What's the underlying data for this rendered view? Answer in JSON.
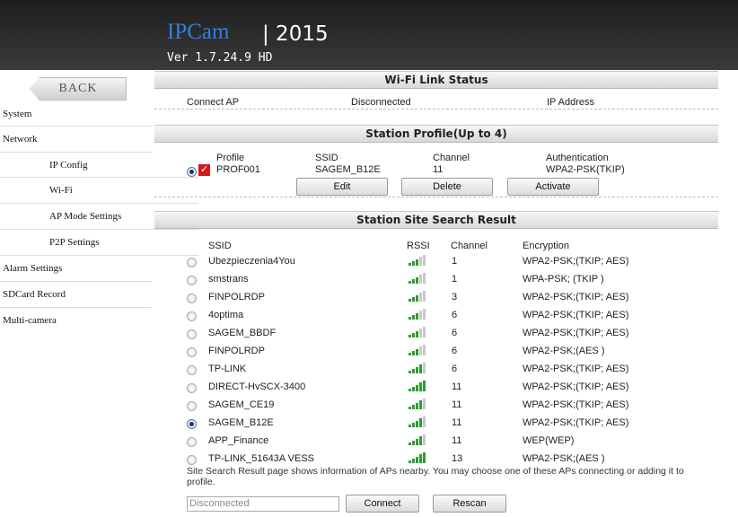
{
  "header": {
    "brand": "IPCam",
    "year": "| 2015",
    "version": "Ver  1.7.24.9 HD"
  },
  "sidebar": {
    "back": "BACK",
    "items": [
      {
        "label": "System"
      },
      {
        "label": "Network"
      },
      {
        "label": "IP Config"
      },
      {
        "label": "Wi-Fi"
      },
      {
        "label": "AP Mode Settings"
      },
      {
        "label": "P2P Settings"
      },
      {
        "label": "Alarm Settings"
      },
      {
        "label": "SDCard Record"
      },
      {
        "label": "Multi-camera"
      }
    ]
  },
  "link_status": {
    "title": "Wi-Fi Link Status",
    "connect_ap_label": "Connect AP",
    "connect_ap_value": "Disconnected",
    "ip_label": "IP Address"
  },
  "profile": {
    "title": "Station Profile(Up to 4)",
    "headers": [
      "Profile",
      "SSID",
      "Channel",
      "Authentication"
    ],
    "row": {
      "profile": "PROF001",
      "ssid": "SAGEM_B12E",
      "channel": "11",
      "auth": "WPA2-PSK(TKIP)"
    },
    "buttons": {
      "edit": "Edit",
      "delete": "Delete",
      "activate": "Activate"
    }
  },
  "search": {
    "title": "Station Site Search Result",
    "headers": [
      "SSID",
      "RSSI",
      "Channel",
      "Encryption"
    ],
    "rows": [
      {
        "ssid": "Ubezpieczenia4You",
        "rssi": 3,
        "channel": "1",
        "enc": "WPA2-PSK;(TKIP; AES)",
        "selected": false
      },
      {
        "ssid": "smstrans",
        "rssi": 3,
        "channel": "1",
        "enc": "WPA-PSK; (TKIP )",
        "selected": false
      },
      {
        "ssid": "FINPOLRDP",
        "rssi": 3,
        "channel": "3",
        "enc": "WPA2-PSK;(TKIP; AES)",
        "selected": false
      },
      {
        "ssid": "4optima",
        "rssi": 3,
        "channel": "6",
        "enc": "WPA2-PSK;(TKIP; AES)",
        "selected": false
      },
      {
        "ssid": "SAGEM_BBDF",
        "rssi": 3,
        "channel": "6",
        "enc": "WPA2-PSK;(TKIP; AES)",
        "selected": false
      },
      {
        "ssid": "FINPOLRDP",
        "rssi": 3,
        "channel": "6",
        "enc": "WPA2-PSK;(AES )",
        "selected": false
      },
      {
        "ssid": "TP-LINK",
        "rssi": 4,
        "channel": "6",
        "enc": "WPA2-PSK;(TKIP; AES)",
        "selected": false
      },
      {
        "ssid": "DIRECT-HvSCX-3400",
        "rssi": 5,
        "channel": "11",
        "enc": "WPA2-PSK;(TKIP; AES)",
        "selected": false
      },
      {
        "ssid": "SAGEM_CE19",
        "rssi": 4,
        "channel": "11",
        "enc": "WPA2-PSK;(TKIP; AES)",
        "selected": false
      },
      {
        "ssid": "SAGEM_B12E",
        "rssi": 4,
        "channel": "11",
        "enc": "WPA2-PSK;(TKIP; AES)",
        "selected": true
      },
      {
        "ssid": "APP_Finance",
        "rssi": 4,
        "channel": "11",
        "enc": "WEP(WEP)",
        "selected": false
      },
      {
        "ssid": "TP-LINK_51643A VESS",
        "rssi": 5,
        "channel": "13",
        "enc": "WPA2-PSK;(AES )",
        "selected": false
      }
    ],
    "note": "Site Search Result page shows information of APs nearby. You may choose one of these APs connecting or adding it to profile.",
    "status_value": "Disconnected",
    "connect": "Connect",
    "rescan": "Rescan"
  },
  "colors": {
    "accent": "#2f7fdf",
    "signal_on": "#2e9e2e",
    "signal_off": "#c8c8c8",
    "check_bg": "#d11a1a"
  }
}
